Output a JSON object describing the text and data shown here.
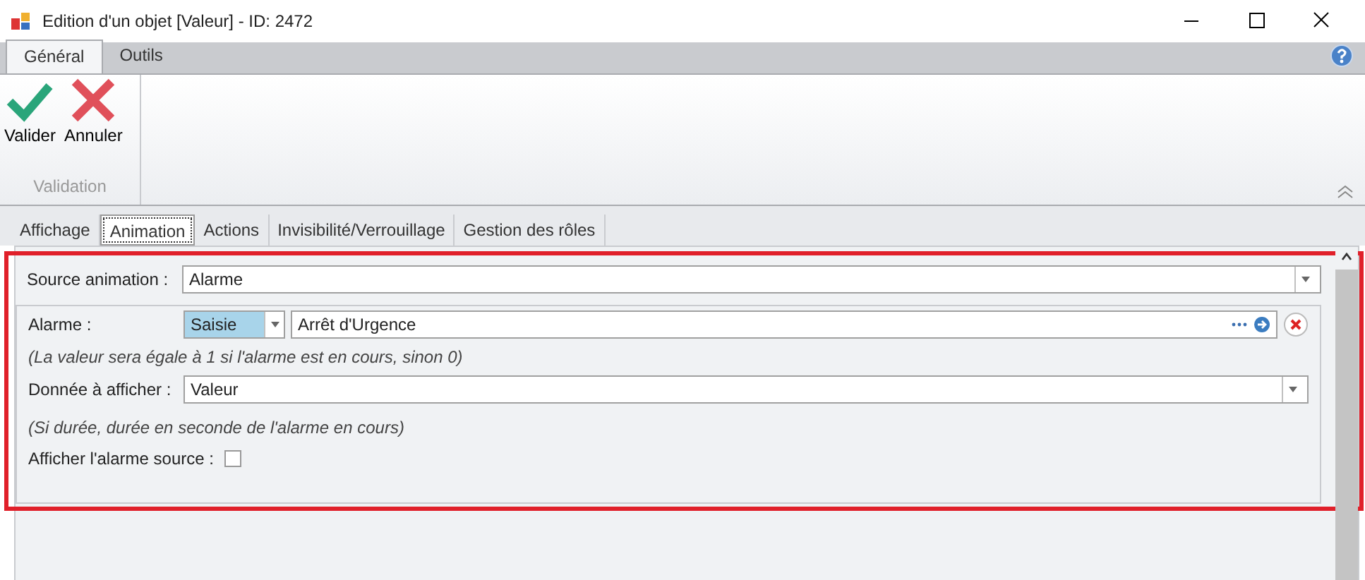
{
  "window": {
    "title": "Edition d'un objet [Valeur] - ID: 2472"
  },
  "ribbon_tabs": [
    {
      "label": "Général",
      "selected": true
    },
    {
      "label": "Outils",
      "selected": false
    }
  ],
  "ribbon_buttons": [
    {
      "kind": "ok",
      "label": "Valider"
    },
    {
      "kind": "cancel",
      "label": "Annuler"
    }
  ],
  "ribbon_group": "Validation",
  "tabs": [
    {
      "label": "Affichage",
      "selected": false
    },
    {
      "label": "Animation",
      "selected": true
    },
    {
      "label": "Actions",
      "selected": false
    },
    {
      "label": "Invisibilité/Verrouillage",
      "selected": false
    },
    {
      "label": "Gestion des rôles",
      "selected": false
    }
  ],
  "form": {
    "source_label": "Source animation :",
    "source_value": "Alarme",
    "alarm_label": "Alarme :",
    "alarm_mode": "Saisie",
    "alarm_value": "Arrêt d'Urgence",
    "alarm_hint": "(La valeur sera égale à 1 si l'alarme est en cours, sinon 0)",
    "data_label": "Donnée à afficher :",
    "data_value": "Valeur",
    "data_hint": "(Si durée, durée en seconde de l'alarme en cours)",
    "show_source_label": "Afficher l'alarme source :",
    "show_source_checked": false
  }
}
